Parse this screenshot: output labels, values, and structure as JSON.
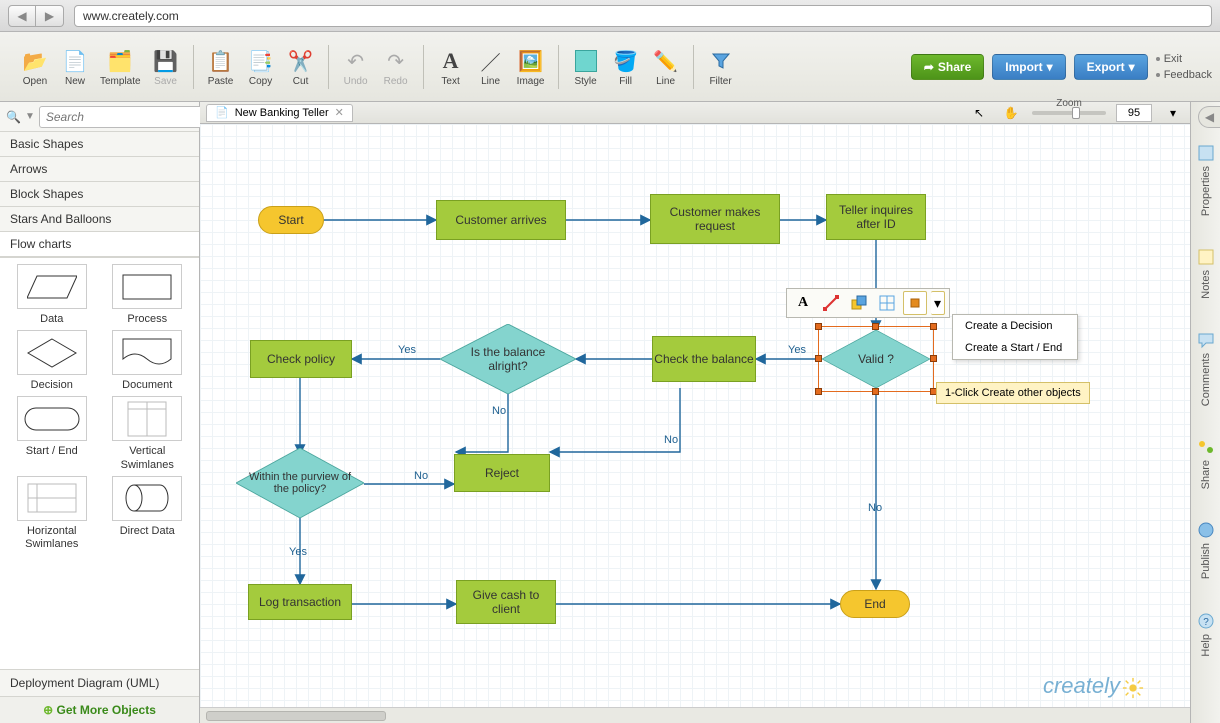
{
  "browser": {
    "url": "www.creately.com"
  },
  "toolbar": {
    "open": "Open",
    "new": "New",
    "template": "Template",
    "save": "Save",
    "paste": "Paste",
    "copy": "Copy",
    "cut": "Cut",
    "undo": "Undo",
    "redo": "Redo",
    "text": "Text",
    "line": "Line",
    "image": "Image",
    "style": "Style",
    "fill": "Fill",
    "line2": "Line",
    "filter": "Filter"
  },
  "actions": {
    "share": "Share",
    "import": "Import",
    "export": "Export",
    "exit": "Exit",
    "feedback": "Feedback"
  },
  "sidebar": {
    "search_placeholder": "Search",
    "categories": [
      "Basic Shapes",
      "Arrows",
      "Block Shapes",
      "Stars And Balloons",
      "Flow charts"
    ],
    "shapes": [
      "Data",
      "Process",
      "Decision",
      "Document",
      "Start / End",
      "Vertical Swimlanes",
      "Horizontal Swimlanes",
      "Direct Data"
    ],
    "deployment": "Deployment Diagram (UML)",
    "get_more": "Get More Objects"
  },
  "tab": {
    "title": "New Banking Teller"
  },
  "zoom": {
    "label": "Zoom",
    "value": "95"
  },
  "nodes": {
    "start": "Start",
    "cust_arrives": "Customer arrives",
    "cust_request": "Customer makes request",
    "teller_inquires": "Teller inquires after ID",
    "valid": "Valid ?",
    "check_balance": "Check the balance",
    "balance_ok": "Is the balance alright?",
    "check_policy": "Check policy",
    "within_policy": "Within the purview of the policy?",
    "reject": "Reject",
    "log_txn": "Log transaction",
    "give_cash": "Give cash to client",
    "end": "End"
  },
  "labels": {
    "yes": "Yes",
    "no": "No"
  },
  "context": {
    "menu": [
      "Create a Decision",
      "Create a Start / End"
    ],
    "tooltip": "1-Click Create other objects"
  },
  "dock": [
    "Properties",
    "Notes",
    "Comments",
    "Share",
    "Publish",
    "Help"
  ],
  "logo": "creately"
}
